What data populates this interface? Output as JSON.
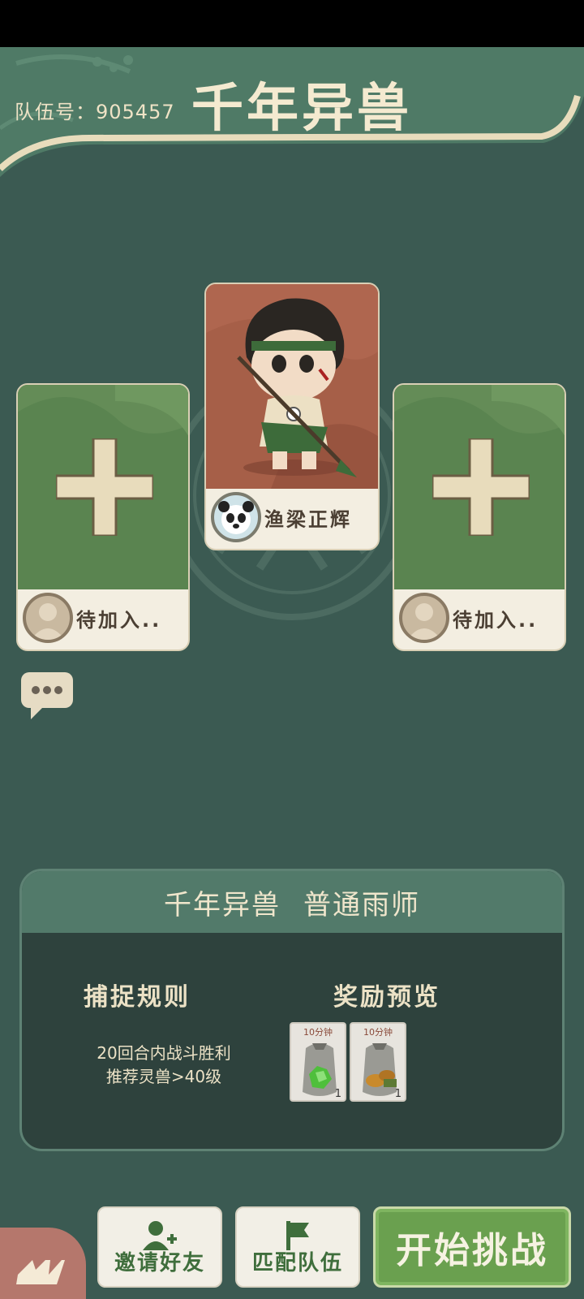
{
  "header": {
    "team_label": "队伍号：905457",
    "title": "千年异兽"
  },
  "cards": {
    "left": {
      "label": "待加入..",
      "icon": "plus-icon",
      "status": "empty"
    },
    "center": {
      "label": "渔梁正辉",
      "avatar_icon": "panda-icon"
    },
    "right": {
      "label": "待加入..",
      "icon": "plus-icon",
      "status": "empty"
    }
  },
  "chat": {
    "icon": "chat-bubble-icon"
  },
  "info": {
    "title_left": "千年异兽",
    "title_right": "普通雨师",
    "rules_title": "捕捉规则",
    "rules_line1": "20回合内战斗胜利",
    "rules_line2": "推荐灵兽>40级",
    "rewards_title": "奖励预览",
    "rewards": [
      {
        "time": "10分钟",
        "count": "1",
        "icon": "green-gem-bag-icon"
      },
      {
        "time": "10分钟",
        "count": "1",
        "icon": "gold-bag-icon"
      }
    ]
  },
  "buttons": {
    "invite": "邀请好友",
    "match": "匹配队伍",
    "start": "开始挑战"
  },
  "colors": {
    "background": "#3b5a52",
    "card_green": "#5d8650",
    "start_green": "#6aa04f",
    "cream": "#f3eee1"
  }
}
